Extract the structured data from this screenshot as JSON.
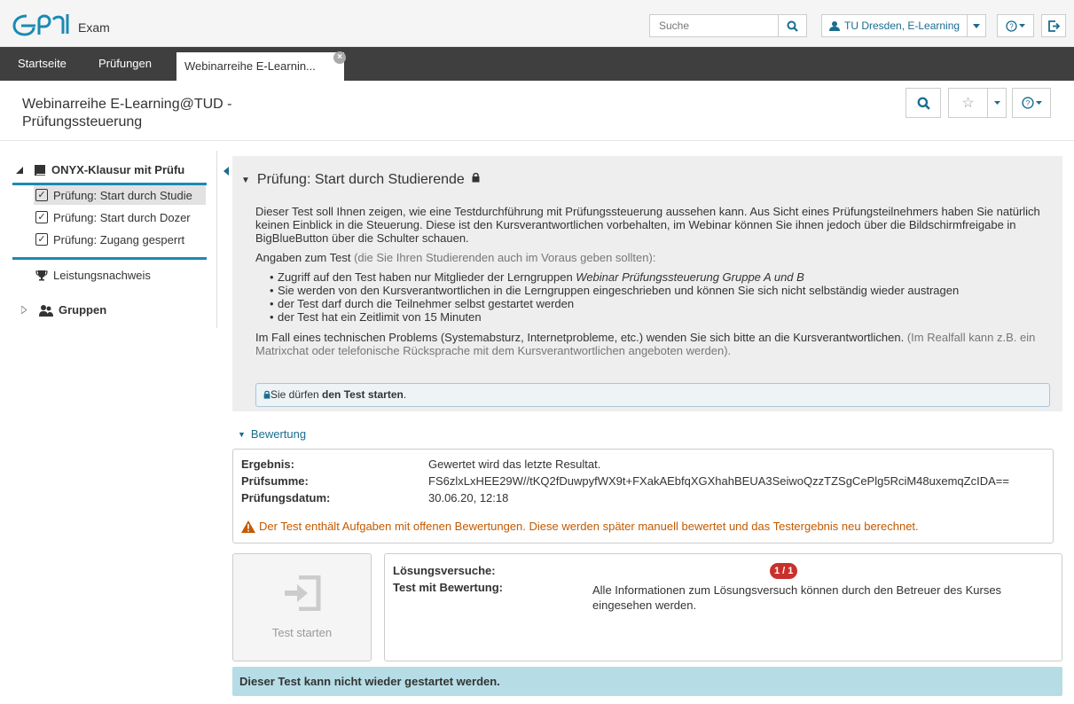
{
  "header": {
    "logo_text": "Exam",
    "search_placeholder": "Suche",
    "user_label": "TU Dresden, E-Learning"
  },
  "nav": {
    "items": [
      "Startseite",
      "Prüfungen"
    ],
    "active_tab": "Webinarreihe E-Learnin..."
  },
  "course": {
    "title": "Webinarreihe E-Learning@TUD - Prüfungssteuerung"
  },
  "sidebar": {
    "root": "ONYX-Klausur mit Prüfu",
    "children": [
      "Prüfung: Start durch Studie",
      "Prüfung: Start durch Dozer",
      "Prüfung: Zugang gesperrt"
    ],
    "leistungsnachweis": "Leistungsnachweis",
    "gruppen": "Gruppen"
  },
  "panel": {
    "title": "Prüfung: Start durch Studierende",
    "intro": "Dieser Test soll Ihnen zeigen, wie eine Testdurchführung mit Prüfungssteuerung aussehen kann. Aus Sicht eines Prüfungsteilnehmers haben Sie natürlich keinen Einblick in die Steuerung. Diese ist den Kursverantwortlichen vorbehalten, im Webinar können Sie ihnen jedoch über die Bildschirmfreigabe in BigBlueButton über die Schulter schauen.",
    "angaben_label": "Angaben zum Test",
    "angaben_hint": " (die Sie Ihren Studierenden auch im Voraus geben sollten):",
    "bullet1_prefix": "Zugriff auf den Test haben nur Mitglieder der Lerngruppen ",
    "bullet1_em": "Webinar Prüfungssteuerung Gruppe A und B",
    "bullet2": "Sie werden von den Kursverantwortlichen in die Lerngruppen eingeschrieben und können Sie sich nicht selbständig wieder austragen",
    "bullet3": "der Test darf durch die Teilnehmer selbst gestartet werden",
    "bullet4": "der Test hat ein Zeitlimit von 15 Minuten",
    "problem_text": "Im Fall eines technischen Problems (Systemabsturz, Internetprobleme, etc.) wenden Sie sich bitte an die Kursverantwortlichen.",
    "problem_hint": " (Im Realfall kann z.B. ein Matrixchat oder telefonische Rücksprache mit dem Kursverantwortlichen angeboten werden).",
    "notice_prefix": "Sie dürfen ",
    "notice_bold": "den Test starten",
    "notice_suffix": "."
  },
  "bewertung": {
    "toggle": "Bewertung",
    "ergebnis_label": "Ergebnis:",
    "ergebnis_value": "Gewertet wird das letzte Resultat.",
    "pruefsumme_label": "Prüfsumme:",
    "pruefsumme_value": "FS6zlxLxHEE29W//tKQ2fDuwpyfWX9t+FXakAEbfqXGXhahBEUA3SeiwoQzzTZSgCePlg5RciM48uxemqZcIDA==",
    "datum_label": "Prüfungsdatum:",
    "datum_value": "30.06.20, 12:18",
    "warning": "Der Test enthält Aufgaben mit offenen Bewertungen. Diese werden später manuell bewertet und das Testergebnis neu berechnet."
  },
  "start": {
    "button_label": "Test starten",
    "versuche_label": "Lösungsversuche:",
    "versuche_badge": "1 / 1",
    "bewertung_label": "Test mit Bewertung:",
    "bewertung_value": "Alle Informationen zum Lösungsversuch können durch den Betreuer des Kurses eingesehen werden."
  },
  "final_message": "Dieser Test kann nicht wieder gestartet werden.",
  "colors": {
    "accent": "#1a6d8e",
    "nav_bg": "#3f3f3f",
    "warning": "#c35a00",
    "badge": "#c9302c",
    "final_bar": "#b6dde6"
  }
}
